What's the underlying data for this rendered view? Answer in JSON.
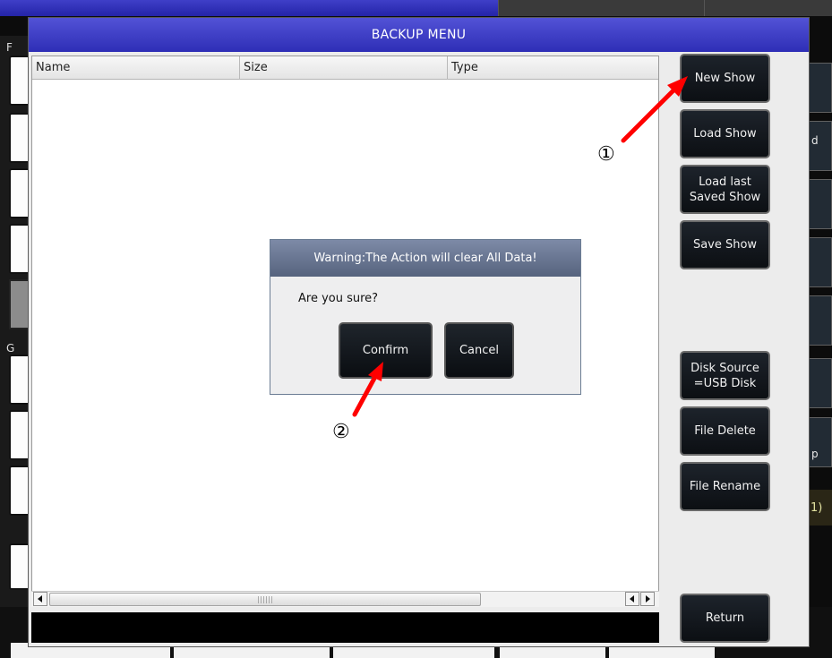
{
  "dialog": {
    "title": "BACKUP MENU",
    "columns": [
      "Name",
      "Size",
      "Type"
    ]
  },
  "side_buttons": {
    "new_show": "New Show",
    "load_show": "Load Show",
    "load_last_saved": "Load last\nSaved Show",
    "save_show": "Save Show",
    "disk_source": "Disk Source\n=USB Disk",
    "file_delete": "File Delete",
    "file_rename": "File Rename",
    "return": "Return"
  },
  "warning": {
    "title": "Warning:The Action will clear All Data!",
    "message": "Are you sure?",
    "confirm": "Confirm",
    "cancel": "Cancel"
  },
  "scrollbar": {
    "left_icon": "arrow-left-icon",
    "right_icon": "arrow-right-icon"
  },
  "background_app": {
    "left_letters": [
      "F",
      "G"
    ],
    "right_fragments": [
      "d",
      "p",
      "1)"
    ]
  },
  "annotations": {
    "step1": "①",
    "step2": "②",
    "arrow_color": "#ff0000"
  },
  "colors": {
    "title_bar": "#3a3ac4",
    "popup_title": "#6a7794",
    "button_bg": "#141a20"
  }
}
